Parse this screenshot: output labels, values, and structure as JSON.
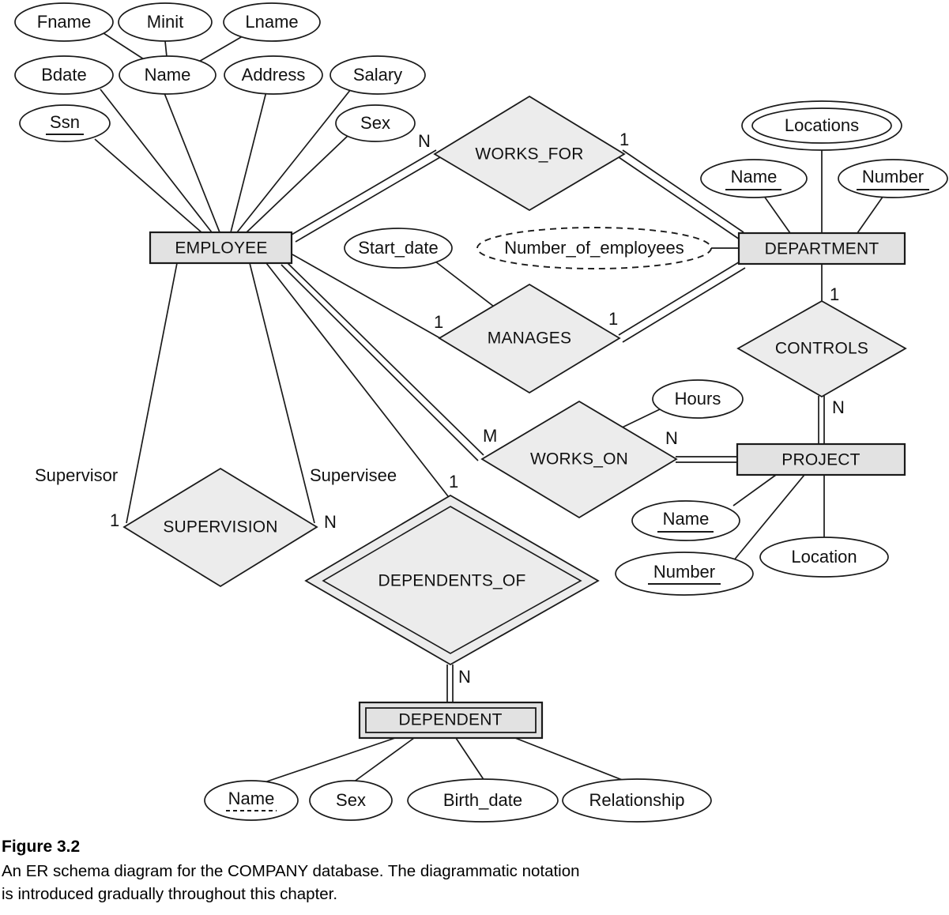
{
  "figure": {
    "label": "Figure 3.2",
    "caption_line1": "An ER schema diagram for the COMPANY database. The diagrammatic notation",
    "caption_line2": "is introduced gradually throughout this chapter."
  },
  "colors": {
    "entity_fill": "#e2e2e2",
    "relationship_fill": "#ececec",
    "attribute_fill": "#ffffff",
    "stroke": "#1a1a1a"
  },
  "diagram": {
    "type": "er-schema",
    "title": "COMPANY database ER schema",
    "entities": [
      {
        "id": "employee",
        "name": "EMPLOYEE",
        "kind": "strong"
      },
      {
        "id": "department",
        "name": "DEPARTMENT",
        "kind": "strong"
      },
      {
        "id": "project",
        "name": "PROJECT",
        "kind": "strong"
      },
      {
        "id": "dependent",
        "name": "DEPENDENT",
        "kind": "weak"
      }
    ],
    "relationships": [
      {
        "id": "works_for",
        "name": "WORKS_FOR",
        "kind": "normal",
        "left_card": "N",
        "right_card": "1",
        "participants": [
          "EMPLOYEE",
          "DEPARTMENT"
        ]
      },
      {
        "id": "manages",
        "name": "MANAGES",
        "kind": "normal",
        "left_card": "1",
        "right_card": "1",
        "participants": [
          "EMPLOYEE",
          "DEPARTMENT"
        ]
      },
      {
        "id": "controls",
        "name": "CONTROLS",
        "kind": "normal",
        "left_card": "1",
        "right_card": "N",
        "participants": [
          "DEPARTMENT",
          "PROJECT"
        ]
      },
      {
        "id": "works_on",
        "name": "WORKS_ON",
        "kind": "normal",
        "left_card": "M",
        "right_card": "N",
        "participants": [
          "EMPLOYEE",
          "PROJECT"
        ]
      },
      {
        "id": "supervision",
        "name": "SUPERVISION",
        "kind": "normal",
        "left_card": "1",
        "right_card": "N",
        "participants": [
          "EMPLOYEE",
          "EMPLOYEE"
        ]
      },
      {
        "id": "dependents_of",
        "name": "DEPENDENTS_OF",
        "kind": "identifying",
        "left_card": "1",
        "right_card": "N",
        "participants": [
          "EMPLOYEE",
          "DEPENDENT"
        ]
      }
    ],
    "roles": [
      {
        "id": "supervisor",
        "label": "Supervisor"
      },
      {
        "id": "supervisee",
        "label": "Supervisee"
      }
    ],
    "cardinality_labels": {
      "works_for_n": "N",
      "works_for_1": "1",
      "manages_left_1": "1",
      "manages_right_1": "1",
      "controls_1": "1",
      "controls_n": "N",
      "works_on_m": "M",
      "works_on_n": "N",
      "supervision_1": "1",
      "supervision_n": "N",
      "dependents_of_1": "1",
      "dependents_of_n": "N"
    },
    "attributes": {
      "employee": [
        {
          "id": "emp_fname",
          "label": "Fname",
          "kind": "simple"
        },
        {
          "id": "emp_minit",
          "label": "Minit",
          "kind": "simple"
        },
        {
          "id": "emp_lname",
          "label": "Lname",
          "kind": "simple"
        },
        {
          "id": "emp_name",
          "label": "Name",
          "kind": "composite"
        },
        {
          "id": "emp_bdate",
          "label": "Bdate",
          "kind": "simple"
        },
        {
          "id": "emp_address",
          "label": "Address",
          "kind": "simple"
        },
        {
          "id": "emp_salary",
          "label": "Salary",
          "kind": "simple"
        },
        {
          "id": "emp_ssn",
          "label": "Ssn",
          "kind": "key"
        },
        {
          "id": "emp_sex",
          "label": "Sex",
          "kind": "simple"
        }
      ],
      "department": [
        {
          "id": "dept_locations",
          "label": "Locations",
          "kind": "multivalued"
        },
        {
          "id": "dept_name",
          "label": "Name",
          "kind": "key"
        },
        {
          "id": "dept_number",
          "label": "Number",
          "kind": "key"
        },
        {
          "id": "dept_noe",
          "label": "Number_of_employees",
          "kind": "derived"
        }
      ],
      "project": [
        {
          "id": "proj_name",
          "label": "Name",
          "kind": "key"
        },
        {
          "id": "proj_number",
          "label": "Number",
          "kind": "key"
        },
        {
          "id": "proj_location",
          "label": "Location",
          "kind": "simple"
        }
      ],
      "dependent": [
        {
          "id": "dep_name",
          "label": "Name",
          "kind": "partial-key"
        },
        {
          "id": "dep_sex",
          "label": "Sex",
          "kind": "simple"
        },
        {
          "id": "dep_birth_date",
          "label": "Birth_date",
          "kind": "simple"
        },
        {
          "id": "dep_relationship",
          "label": "Relationship",
          "kind": "simple"
        }
      ],
      "manages": [
        {
          "id": "man_start_date",
          "label": "Start_date",
          "kind": "simple"
        }
      ],
      "works_on": [
        {
          "id": "won_hours",
          "label": "Hours",
          "kind": "simple"
        }
      ]
    }
  }
}
